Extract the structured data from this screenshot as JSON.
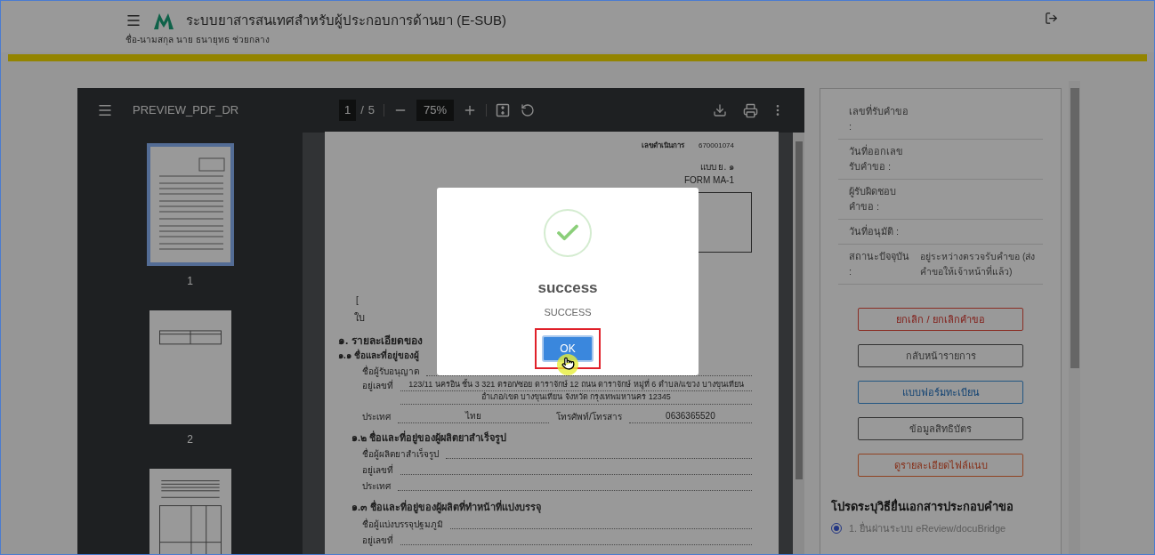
{
  "header": {
    "title": "ระบบยาสารสนเทศสำหรับผู้ประกอบการด้านยา (E-SUB)",
    "user_name": "ชื่อ-นามสกุล นาย ธนายุทธ ช่วยกลาง"
  },
  "pdf_viewer": {
    "file_name": "PREVIEW_PDF_DR",
    "page_current": "1",
    "page_separator": "/",
    "page_total": "5",
    "zoom": "75%",
    "thumbnails": [
      {
        "label": "1",
        "selected": true,
        "kind": "form"
      },
      {
        "label": "2",
        "selected": false,
        "kind": "table"
      },
      {
        "selected": false,
        "kind": "grid"
      }
    ]
  },
  "document": {
    "ref_label": "เลขดำเนินการ",
    "ref_number": "670001074",
    "form_code_th": "แบบ ย. ๑",
    "form_code_en": "FORM MA-1",
    "partial_bracket": "[",
    "partial_text": "ใบ",
    "section_title": "๑. รายละเอียดของ",
    "subsections": [
      {
        "title": "๑.๑ ชื่อและที่อยู่ของผู้",
        "fields": [
          {
            "kind": "line",
            "label": "ชื่อผู้รับอนุญาต"
          },
          {
            "kind": "address",
            "label": "อยู่เลขที่",
            "value": "123/11 นครอิน ชั้น 3 321 ตรอก/ซอย ดาราจักษ์ 12 ถนน ดาราจักษ์ หมู่ที่ 6 ตำบล/แขวง บางขุนเทียน",
            "value_2": "อำเภอ/เขต บางขุนเทียน จังหวัด กรุงเทพมหานคร 12345"
          },
          {
            "kind": "country",
            "label": "ประเทศ",
            "value": "ไทย",
            "phone_label": "โทรศัพท์/โทรสาร",
            "phone": "0636365520"
          }
        ]
      },
      {
        "title": "๑.๒ ชื่อและที่อยู่ของผู้ผลิตยาสำเร็จรูป",
        "fields": [
          {
            "kind": "line",
            "label": "ชื่อผู้ผลิตยาสำเร็จรูป"
          },
          {
            "kind": "line",
            "label": "อยู่เลขที่"
          },
          {
            "kind": "line",
            "label": "ประเทศ"
          }
        ]
      },
      {
        "title": "๑.๓ ชื่อและที่อยู่ของผู้ผลิตที่ทำหน้าที่แบ่งบรรจุ",
        "fields": [
          {
            "kind": "line",
            "label": "ชื่อผู้แบ่งบรรจุปฐมภูมิ"
          },
          {
            "kind": "line",
            "label": "อยู่เลขที่"
          }
        ]
      }
    ]
  },
  "side_panel": {
    "info_rows": [
      {
        "label": "เลขที่รับคำขอ :"
      },
      {
        "label": "วันที่ออกเลขรับคำขอ :"
      },
      {
        "label": "ผู้รับผิดชอบคำขอ :"
      },
      {
        "label": "วันที่อนุมัติ :"
      },
      {
        "label": "สถานะปัจจุบัน :",
        "value": "อยู่ระหว่างตรวจรับคำขอ (ส่งคำขอให้เจ้าหน้าที่แล้ว)"
      }
    ],
    "buttons": [
      {
        "label": "ยกเลิก / ยกเลิกคำขอ",
        "kind": "danger"
      },
      {
        "label": "กลับหน้ารายการ",
        "kind": "default"
      },
      {
        "label": "แบบฟอร์มทะเบียน",
        "kind": "primary"
      },
      {
        "label": "ข้อมูลสิทธิบัตร",
        "kind": "default"
      },
      {
        "label": "ดูรายละเอียดไฟล์แนบ",
        "kind": "warning"
      }
    ],
    "method_heading": "โปรดระบุวิธียื่นเอกสารประกอบคำขอ",
    "methods": [
      {
        "label": "1. ยื่นผ่านระบบ eReview/docuBridge",
        "selected": true
      }
    ]
  },
  "dialog": {
    "title": "success",
    "message": "SUCCESS",
    "button": "OK"
  }
}
